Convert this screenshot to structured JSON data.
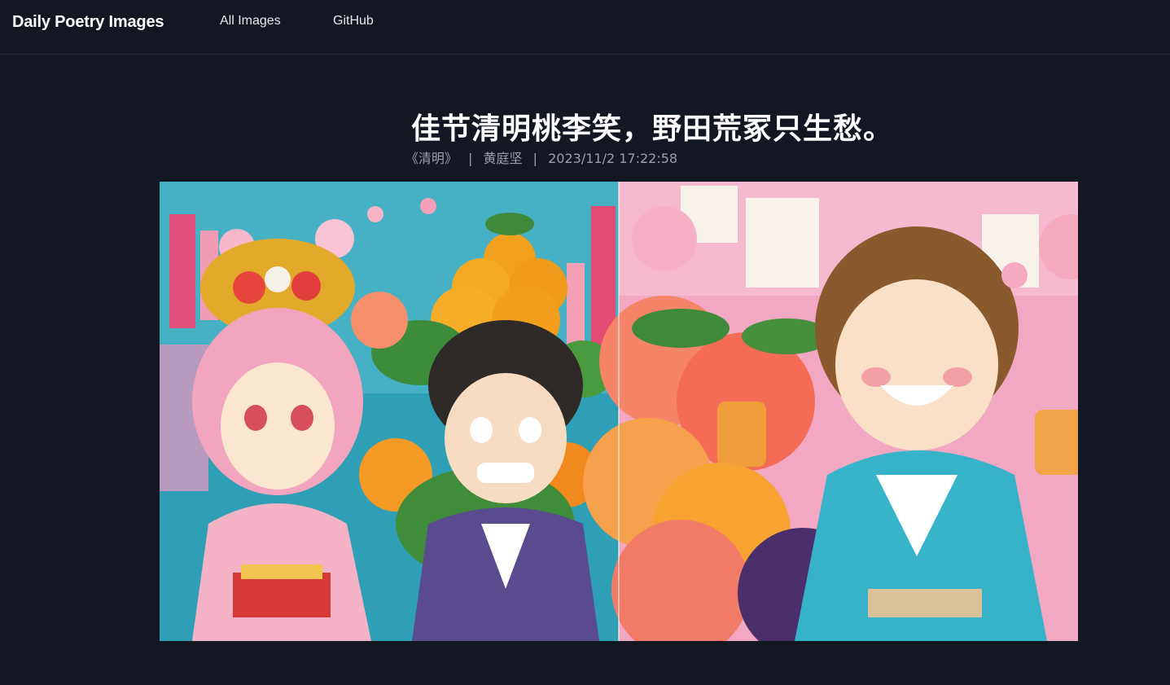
{
  "site": {
    "brand": "Daily Poetry Images",
    "nav": [
      {
        "label": "All Images"
      },
      {
        "label": "GitHub"
      }
    ]
  },
  "poem": {
    "line": "佳节清明桃李笑，野田荒冢只生愁。",
    "work": "《清明》",
    "author": "黄庭坚",
    "datetime": "2023/11/2 17:22:58"
  },
  "image": {
    "panels": [
      {
        "label": "left-panel"
      },
      {
        "label": "right-panel"
      }
    ],
    "colors": {
      "sky": "#2f9fb5",
      "pink": "#f2a7c3",
      "peach": "#f58f6c",
      "orange": "#f2a11f",
      "kimono_pink": "#f3b2c6",
      "kimono_purple": "#5a4a8e",
      "kimono_teal": "#36b2c9",
      "plum": "#4b2f6a",
      "hair_brown": "#8a5a2f"
    }
  }
}
